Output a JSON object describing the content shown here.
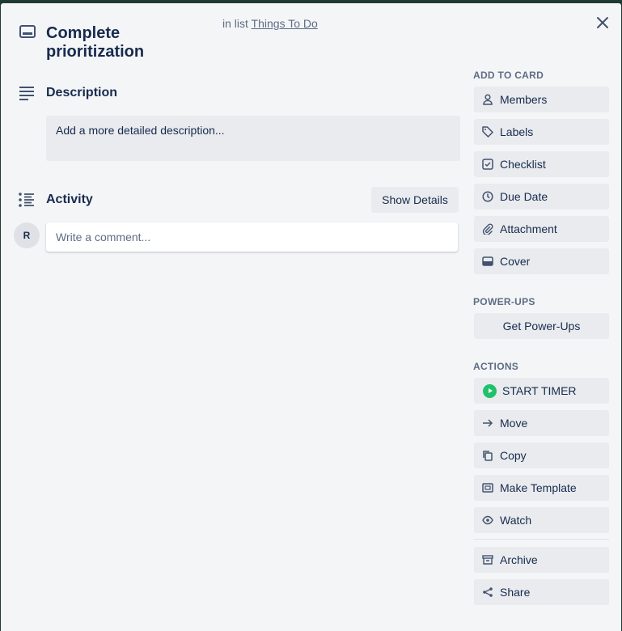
{
  "card": {
    "title_line1": "Complete",
    "title_line2": "prioritization",
    "in_list_prefix": "in list",
    "list_name": "Things To Do"
  },
  "description": {
    "heading": "Description",
    "placeholder": "Add a more detailed description..."
  },
  "activity": {
    "heading": "Activity",
    "show_details": "Show Details",
    "avatar_initial": "R",
    "comment_placeholder": "Write a comment..."
  },
  "sidebar": {
    "add_to_card_heading": "ADD TO CARD",
    "add_to_card": [
      {
        "label": "Members",
        "icon": "person-icon"
      },
      {
        "label": "Labels",
        "icon": "tag-icon"
      },
      {
        "label": "Checklist",
        "icon": "checkbox-icon"
      },
      {
        "label": "Due Date",
        "icon": "clock-icon"
      },
      {
        "label": "Attachment",
        "icon": "paperclip-icon"
      },
      {
        "label": "Cover",
        "icon": "cover-icon"
      }
    ],
    "power_ups_heading": "POWER-UPS",
    "get_power_ups": "Get Power-Ups",
    "actions_heading": "ACTIONS",
    "start_timer": "START TIMER",
    "actions": [
      {
        "label": "Move",
        "icon": "arrow-right-icon"
      },
      {
        "label": "Copy",
        "icon": "copy-icon"
      },
      {
        "label": "Make Template",
        "icon": "template-icon"
      },
      {
        "label": "Watch",
        "icon": "eye-icon"
      }
    ],
    "archive": "Archive",
    "share": "Share"
  },
  "colors": {
    "background": "#1d3b30",
    "modal": "#f4f5f7",
    "button": "#e9ebee",
    "timer_green": "#1fc16b"
  }
}
